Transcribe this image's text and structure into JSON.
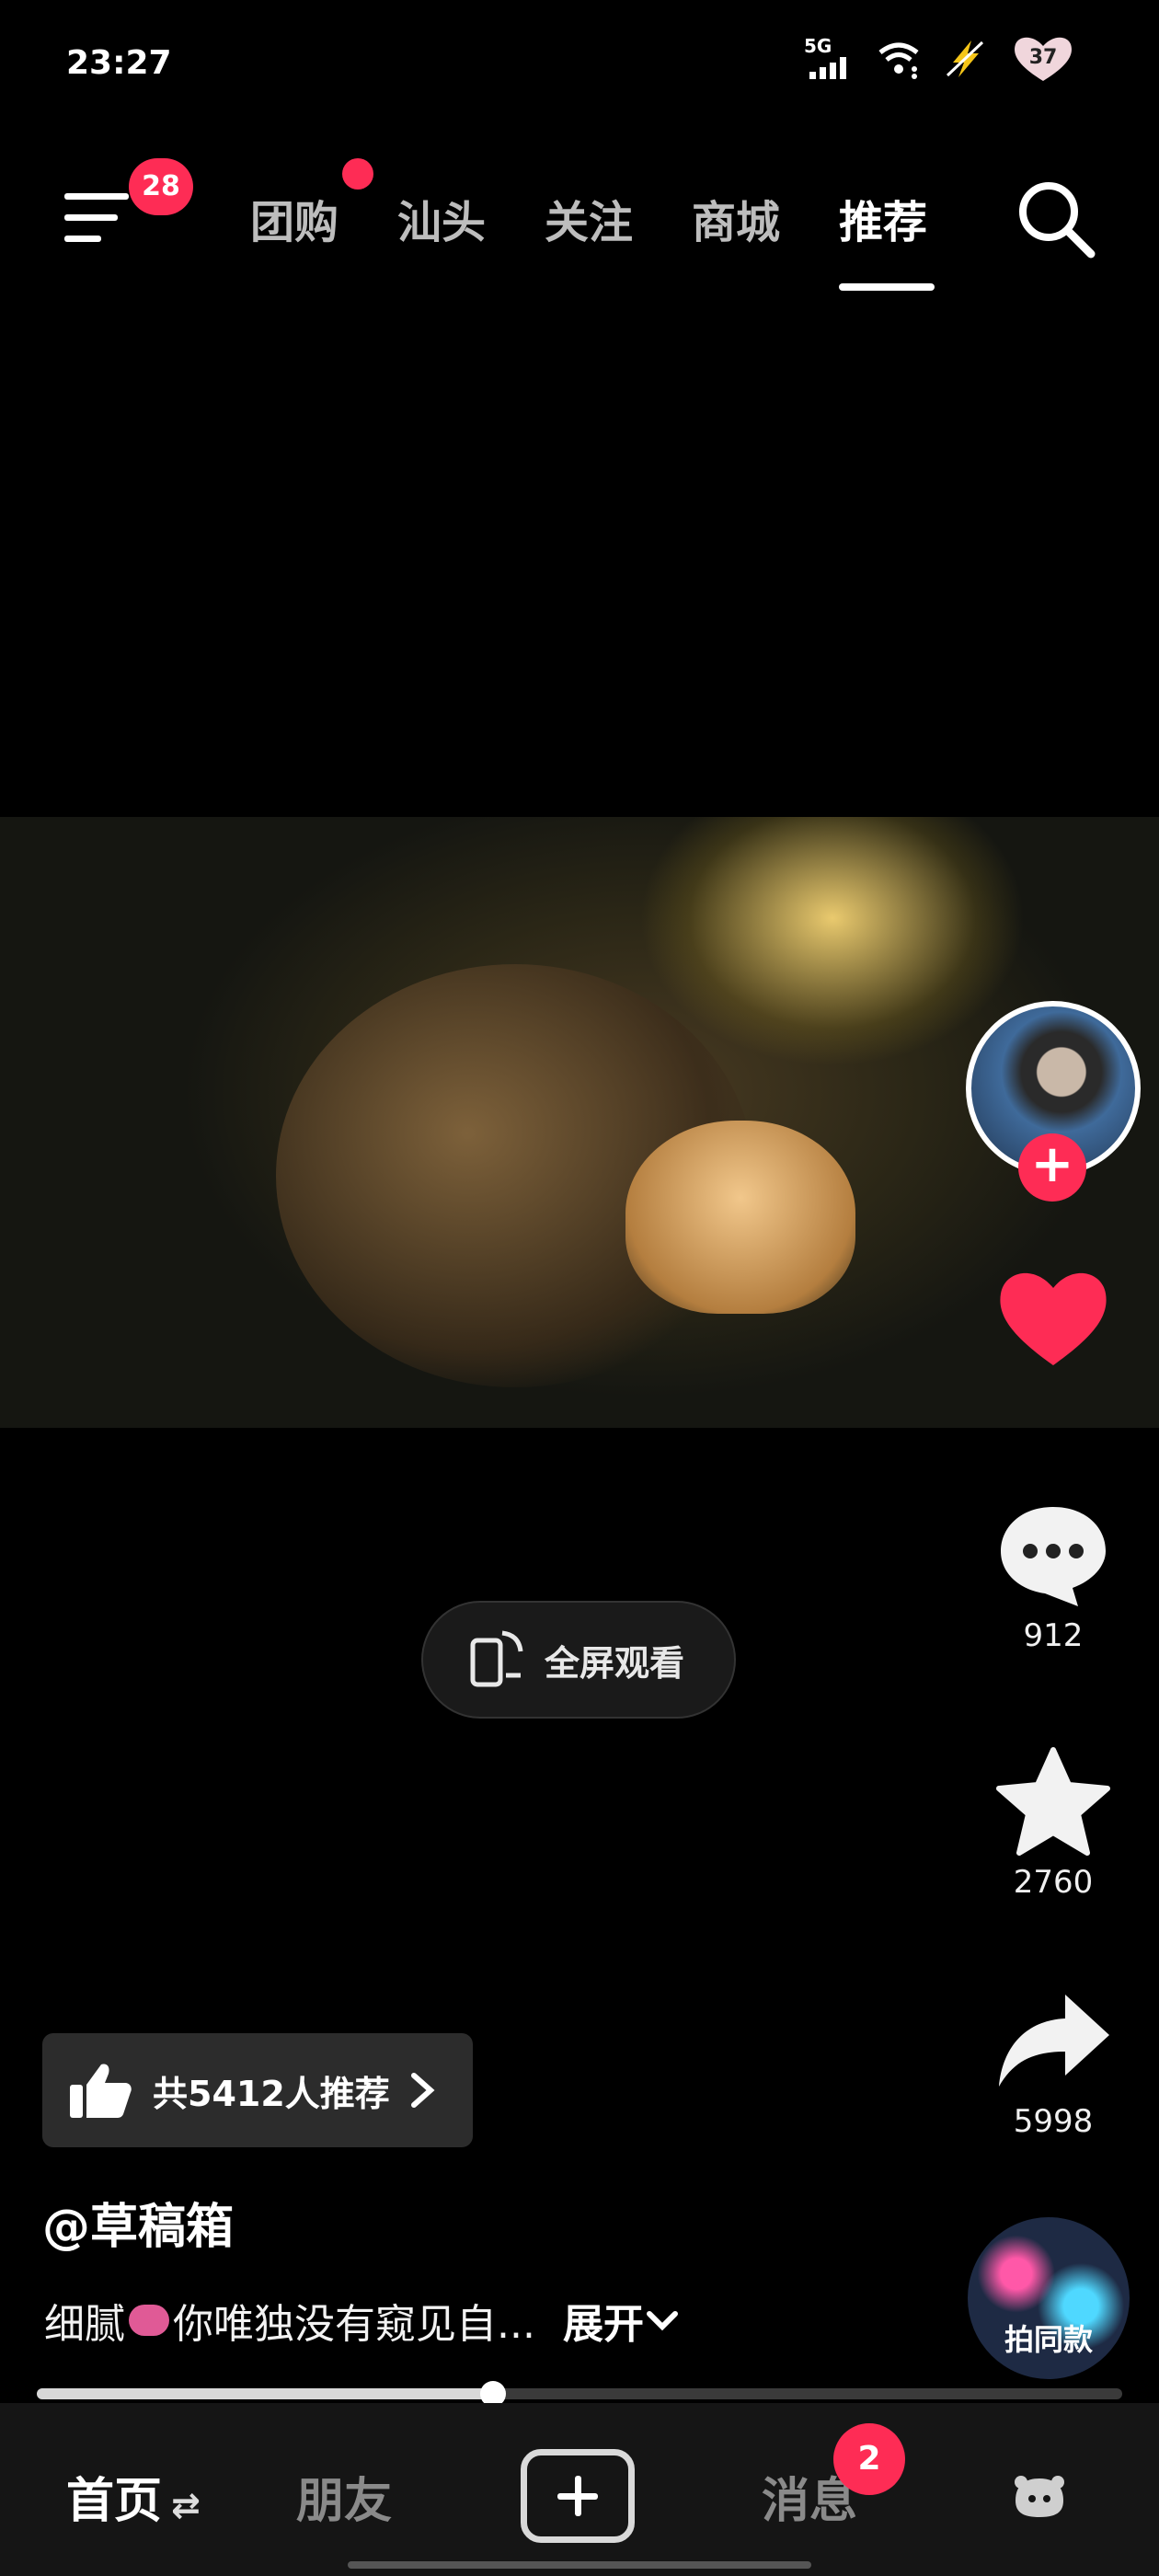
{
  "status": {
    "time": "23:27",
    "network": "5G",
    "battery": "37"
  },
  "topnav": {
    "menu_badge": "28",
    "tabs": [
      {
        "label": "团购",
        "has_dot": true
      },
      {
        "label": "汕头"
      },
      {
        "label": "关注"
      },
      {
        "label": "商城"
      },
      {
        "label": "推荐",
        "active": true
      }
    ]
  },
  "video": {
    "fullscreen_label": "全屏观看"
  },
  "actions": {
    "comments": "912",
    "favorites": "2760",
    "shares": "5998",
    "remix_label": "拍同款"
  },
  "info": {
    "recommend": "共5412人推荐",
    "author": "@草稿箱",
    "desc_before": "细腻",
    "desc_after": "你唯独没有窥见自...",
    "expand": "展开"
  },
  "progress": {
    "fraction": 0.42
  },
  "tabbar": {
    "home": "首页",
    "home_swap": "⇄",
    "friends": "朋友",
    "messages": "消息",
    "messages_badge": "2"
  },
  "colors": {
    "accent": "#fe2c55"
  }
}
